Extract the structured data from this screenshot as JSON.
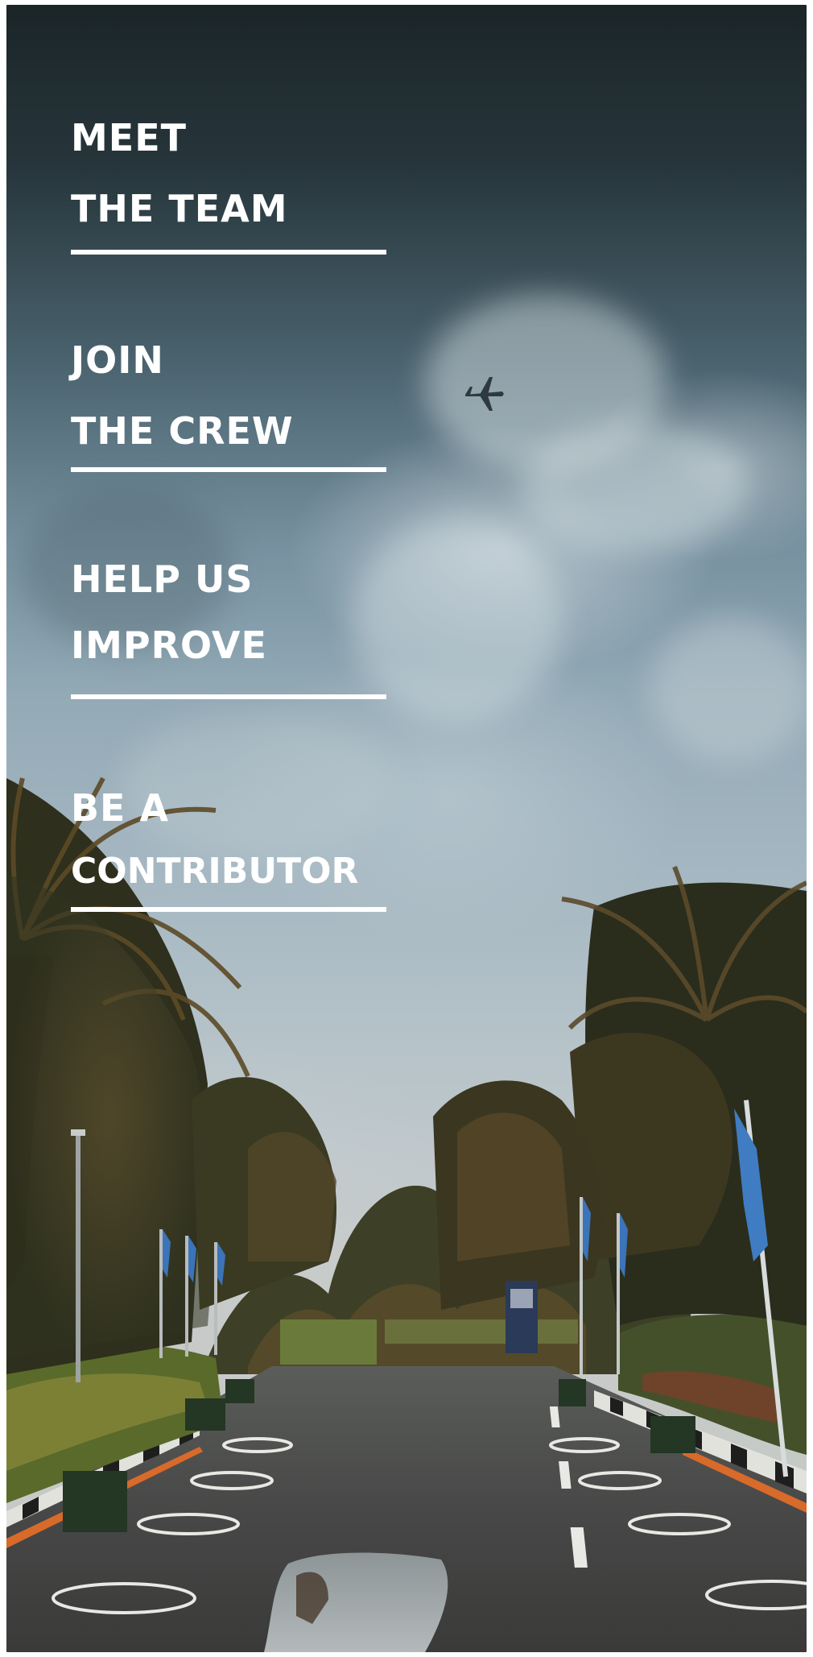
{
  "menu": {
    "items": [
      {
        "line1": "MEET",
        "line2": "THE TEAM"
      },
      {
        "line1": "JOIN",
        "line2": "THE CREW"
      },
      {
        "line1": "HELP US",
        "line2": "IMPROVE"
      },
      {
        "line1": "BE A",
        "line2": "CONTRIBUTOR"
      }
    ]
  },
  "background": {
    "scene": "stormy-sky-palm-lined-wet-road",
    "airplane_icon": "airplane-icon"
  },
  "colors": {
    "menu_text": "#ffffff",
    "menu_rule": "#ffffff",
    "sky_dark": "#1b2528",
    "sky_light": "#c6c8c3"
  }
}
